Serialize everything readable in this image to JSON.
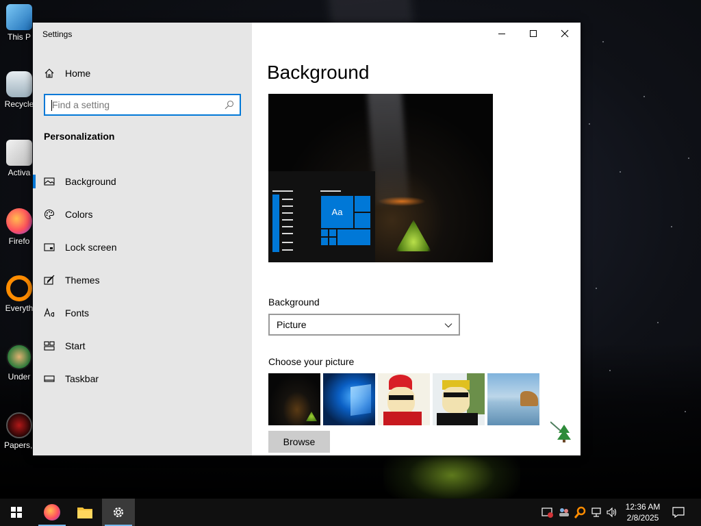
{
  "desktop": {
    "icons": [
      {
        "label": "This P"
      },
      {
        "label": "Recycle"
      },
      {
        "label": "Activa"
      },
      {
        "label": "Firefo"
      },
      {
        "label": "Everyth"
      },
      {
        "label": "Under"
      },
      {
        "label": "Papers, F"
      }
    ]
  },
  "window": {
    "title": "Settings",
    "controls": {
      "minimize": "minimize",
      "maximize": "maximize",
      "close": "close"
    }
  },
  "sidebar": {
    "home_label": "Home",
    "search_placeholder": "Find a setting",
    "search_value": "",
    "section_title": "Personalization",
    "items": [
      {
        "label": "Background",
        "icon": "picture-icon",
        "active": true
      },
      {
        "label": "Colors",
        "icon": "palette-icon",
        "active": false
      },
      {
        "label": "Lock screen",
        "icon": "lock-screen-icon",
        "active": false
      },
      {
        "label": "Themes",
        "icon": "brush-icon",
        "active": false
      },
      {
        "label": "Fonts",
        "icon": "fonts-icon",
        "active": false
      },
      {
        "label": "Start",
        "icon": "start-icon",
        "active": false
      },
      {
        "label": "Taskbar",
        "icon": "taskbar-icon",
        "active": false
      }
    ]
  },
  "main": {
    "title": "Background",
    "preview_tile_text": "Aa",
    "background_label": "Background",
    "background_value": "Picture",
    "choose_label": "Choose your picture",
    "browse_label": "Browse"
  },
  "taskbar": {
    "clock_time": "12:36 AM",
    "clock_date": "2/8/2025"
  },
  "colors": {
    "accent": "#0078d7",
    "sidebar_bg": "#e6e6e6",
    "taskbar_bg": "#101010"
  }
}
